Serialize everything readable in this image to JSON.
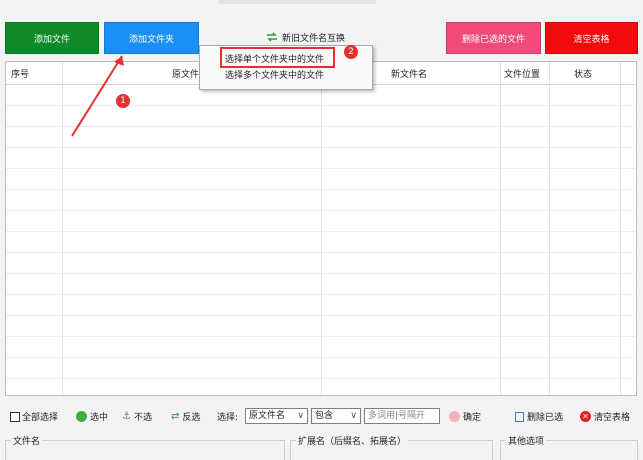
{
  "buttons": {
    "add_file": "添加文件",
    "add_folder": "添加文件夹",
    "swap_names": "新旧文件名互换",
    "delete_selected": "删除已选的文件",
    "clear_table": "清空表格"
  },
  "table": {
    "columns": [
      "序号",
      "原文件",
      "新文件名",
      "文件位置",
      "状态"
    ]
  },
  "dropdown_menu": {
    "items": [
      "选择单个文件夹中的文件",
      "选择多个文件夹中的文件"
    ]
  },
  "badges": {
    "step1": "1",
    "step2": "2"
  },
  "toolbar": {
    "select_all": "全部选择",
    "check": "选中",
    "uncheck": "不选",
    "invert": "反选",
    "select_label": "选择:",
    "select_field": "原文件名",
    "match_mode": "包含",
    "keywords_placeholder": "多词用|号隔开",
    "confirm": "确定",
    "delete_selected": "删除已选",
    "clear_table": "清空表格"
  },
  "groups": {
    "filename": "文件名",
    "extension": "扩展名（后缀名、拓展名）",
    "other": "其他选项"
  },
  "colors": {
    "add_file": "#0f8a2a",
    "add_folder": "#1a8ff5",
    "delete_selected": "#f0497a",
    "clear_table": "#f20b0b",
    "annotation_red": "#e53030"
  }
}
